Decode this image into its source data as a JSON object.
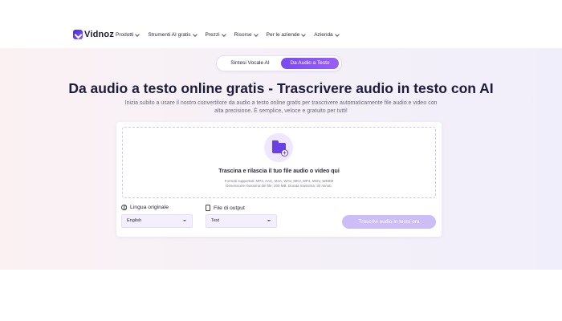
{
  "brand": {
    "name": "Vidnoz"
  },
  "nav": {
    "items": [
      {
        "label": "Prodotti"
      },
      {
        "label": "Strumenti AI gratis"
      },
      {
        "label": "Prezzi"
      },
      {
        "label": "Risorse"
      },
      {
        "label": "Per le aziende"
      },
      {
        "label": "Azienda"
      }
    ]
  },
  "switcher": {
    "tab_tts": "Sintesi Vocale AI",
    "tab_stt": "Da Audio a Testo",
    "active": "Da Audio a Testo"
  },
  "hero": {
    "title": "Da audio a testo online gratis - Trascrivere audio in testo con AI",
    "subtitle": "Inizia subito a usare il nostro convertitore da audio a testo online gratis per trascrivere automaticamente file audio e video con alta precisione. È semplice, veloce e gratuito per tutti!"
  },
  "upload": {
    "title": "Trascina e rilascia il tuo file audio o video qui",
    "formats": "Formati supportati: MP3, AAC, M4A, WAV, MKV, MP4, MOV, WEBM",
    "limits": "Dimensione massima del file: 200 MB. Durata massima: 30 minuti."
  },
  "language": {
    "label": "Lingua originale",
    "value": "English"
  },
  "output": {
    "label": "File di output",
    "value": "Text"
  },
  "action": {
    "label": "Trascrivi audio in testo ora"
  },
  "colors": {
    "accent": "#7a49f2",
    "cta_disabled": "#cdbdf6"
  }
}
